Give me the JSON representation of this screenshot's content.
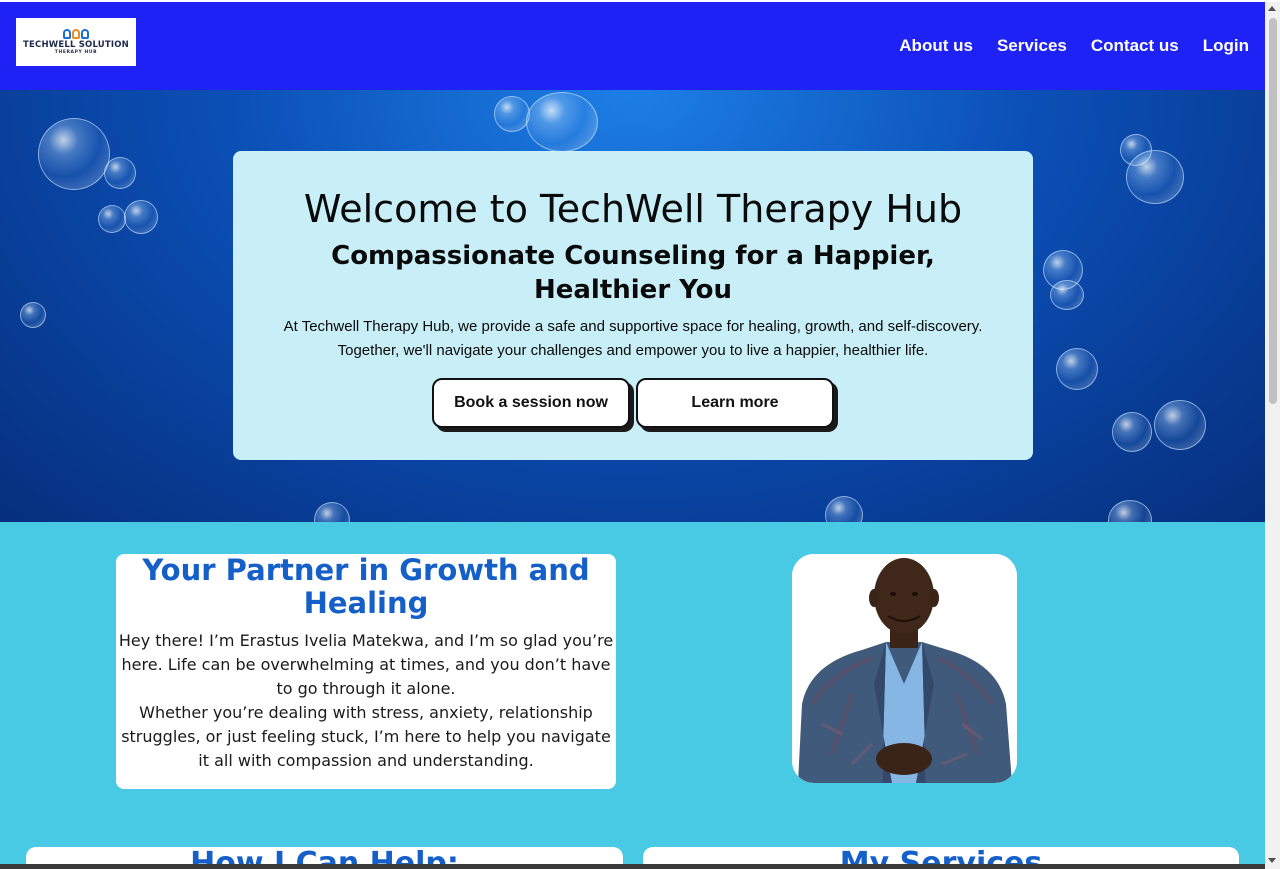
{
  "header": {
    "logo_title": "TECHWELL SOLUTION",
    "logo_subtitle": "THERAPY HUB",
    "nav": [
      "About us",
      "Services",
      "Contact us",
      "Login"
    ],
    "colors": {
      "background": "#1e22f5",
      "text": "#ffffff"
    }
  },
  "hero": {
    "title": "Welcome to TechWell Therapy Hub",
    "subtitle": "Compassionate Counseling for a Happier, Healthier You",
    "text": "At Techwell Therapy Hub, we provide a safe and supportive space for healing, growth, and self-discovery. Together, we'll navigate your challenges and empower you to live a happier, healthier life.",
    "buttons": [
      "Book a session now",
      "Learn more"
    ],
    "colors": {
      "card": "#c8eff7",
      "background": "#0b4fb6"
    }
  },
  "partner": {
    "title": "Your Partner in Growth and Healing",
    "paragraph1": "Hey there! I’m Erastus Ivelia Matekwa, and I’m so glad you’re here. Life can be overwhelming at times, and you don’t have to go through it alone.",
    "paragraph2": "Whether you’re dealing with stress, anxiety, relationship struggles, or just feeling stuck, I’m here to help you navigate it all with compassion and understanding.",
    "colors": {
      "section": "#48c9e4",
      "title": "#155fc9"
    }
  },
  "lower": {
    "left_title": "How I Can Help:",
    "right_title": "My Services"
  }
}
